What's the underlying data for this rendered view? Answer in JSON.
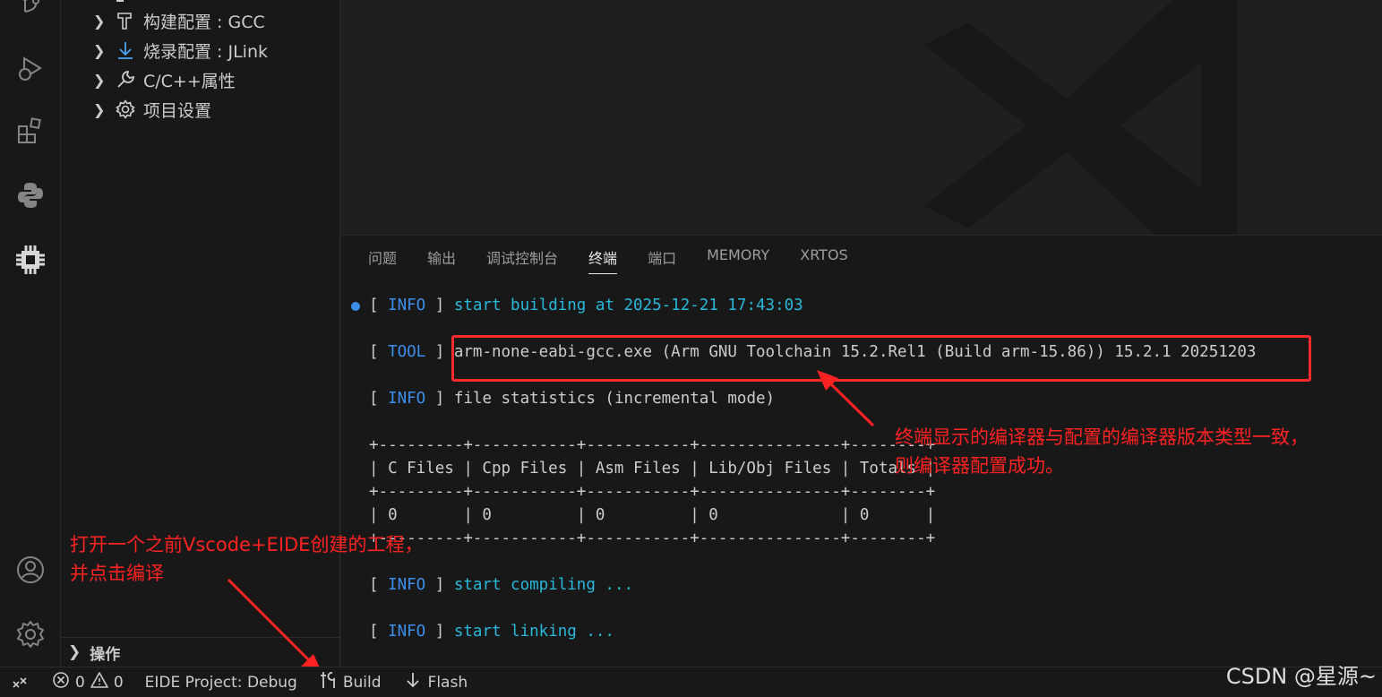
{
  "sidebar": {
    "items": [
      {
        "label": "构建配置 : GCC",
        "icon": "hammer-icon"
      },
      {
        "label": "烧录配置 : JLink",
        "icon": "download-icon"
      },
      {
        "label": "C/C++属性",
        "icon": "wrench-icon"
      },
      {
        "label": "项目设置",
        "icon": "gear-icon"
      }
    ],
    "actions_label": "操作"
  },
  "panel": {
    "tabs": [
      "问题",
      "输出",
      "调试控制台",
      "终端",
      "端口",
      "MEMORY",
      "XRTOS"
    ],
    "active_tab": "终端"
  },
  "terminal": {
    "line1": {
      "tag": "INFO",
      "text": "start building at 2025-12-21 17:43:03"
    },
    "line2": {
      "tag": "TOOL",
      "text": "arm-none-eabi-gcc.exe (Arm GNU Toolchain 15.2.Rel1 (Build arm-15.86)) 15.2.1 20251203"
    },
    "line3": {
      "tag": "INFO",
      "text": "file statistics (incremental mode)"
    },
    "table_border": "+---------+-----------+-----------+---------------+--------+",
    "table_header": "| C Files | Cpp Files | Asm Files | Lib/Obj Files | Totals |",
    "table_values": "| 0       | 0         | 0         | 0             | 0      |",
    "line4": {
      "tag": "INFO",
      "text": "start compiling ..."
    },
    "line5": {
      "tag": "INFO",
      "text": "start linking ..."
    }
  },
  "annotations": {
    "right": "终端显示的编译器与配置的编译器版本类型一致，\n则编译器配置成功。",
    "left": "打开一个之前Vscode+EIDE创建的工程，\n并点击编译"
  },
  "statusbar": {
    "errors": "0",
    "warnings": "0",
    "project": "EIDE Project: Debug",
    "build": "Build",
    "flash": "Flash"
  },
  "watermark": "CSDN @星源~",
  "colors": {
    "accent_red": "#ff2222",
    "info_blue": "#3b8eea",
    "cmd_cyan": "#29b8db"
  }
}
